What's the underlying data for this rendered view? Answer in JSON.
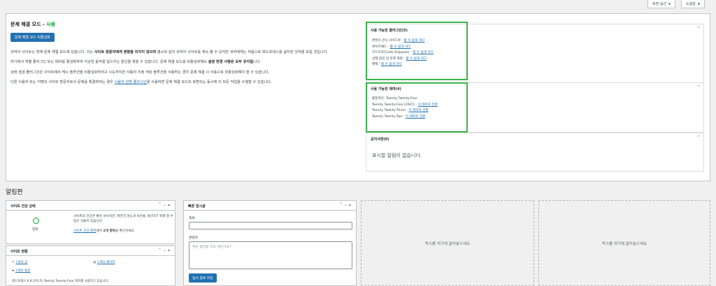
{
  "top_tabs": [
    {
      "label": "화면 옵션"
    },
    {
      "label": "도움말"
    }
  ],
  "troubleshoot": {
    "title_main": "문제 해결 모드 - ",
    "title_status": "사용",
    "disable_button": "문제 해결 모드 비활성화",
    "p1_a": "귀하의 사이트는 현재 문제 해결 모드에 있습니다. 이는 ",
    "p1_bold": "사이트 방문자에게 영향을 미치지 않으며",
    "p1_b": " 평소와 같이 귀하의 사이트를 계속 볼 수 있지만 귀하에게는 처음으로 워드프레스를 설치한 것처럼 보일 것입니다.",
    "p2_a": "여기에서 개별 플러그인 또는 테마를 활성화하여 이상한 동작을 일으키는 원인을 찾을 수 있습니다. 문제 해결 모드를 비활성화해도 ",
    "p2_bold": "설정 변경 사항은 모두 유지됩",
    "p2_b": "니다.",
    "p3": "상태 점검 플러그인은 사이트에서 캐시 솔루션을 비활성화하려고 시도하지만 사용자 지정 캐싱 솔루션을 사용하는 경우 문제 해결 시 수동으로 비활성화해야 할 수 있습니다.",
    "p4_a": "다른 사용자 또는 익명의 사이트 방문자로서 문제를 해결하려는 경우 ",
    "p4_link": "사용자 전환 플러그인",
    "p4_b": "을 사용하면 문제 해결 모드와 호환되는 동시에 이 모든 작업을 수행할 수 있습니다."
  },
  "plugins_box": {
    "title": "사용 가능한 플러그인(5)",
    "items": [
      {
        "name": "콘텐츠 안식 사이드바 - ",
        "link": "활 수 없게 하다"
      },
      {
        "name": "바이즈예드 - ",
        "link": "활 수 없게 하다"
      },
      {
        "name": "코드조각(Code Snippets) - ",
        "link": "활 수 없게 하다"
      },
      {
        "name": "상태 점검 및 문제 해결 - ",
        "link": "활 수 없게 하다"
      },
      {
        "name": "펫팩 - ",
        "link": "활 수 없게 하다"
      }
    ]
  },
  "themes_box": {
    "title": "사용 가능한 테마(4)",
    "items": [
      {
        "name": "활동적인: Twenty Twenty-Four",
        "link": ""
      },
      {
        "name": "Twenty Twenty-Five (2025) - ",
        "link": "이 테마로 전환"
      },
      {
        "name": "Twenty Twenty-Three - ",
        "link": "이 테마로 전환"
      },
      {
        "name": "Twenty Twenty-Two - ",
        "link": "이 테마로 전환"
      }
    ]
  },
  "notices_box": {
    "title": "공지사항(0)",
    "empty": "표시할 알림이 없습니다."
  },
  "dashboard": {
    "title": "알림판",
    "site_health": {
      "title": "사이트 건강 상태",
      "status": "양호",
      "desc": "사이트의 건강은 좋아 보이지만, 여전히 성능과 보안을 개선하기 위해 할 수 있는 것들이 있습니다.",
      "link": "사이트 건강 화면",
      "link_after_a": "에서 ",
      "link_after_bold": "2개 항목",
      "link_after_b": "을 확인하세요."
    },
    "site_overview": {
      "title": "사이트 현황",
      "posts": "1개의 글",
      "pages": "1개의 페이지",
      "comments": "1개의 댓글",
      "footer": "워드프레스 6.8.2이(가) Twenty Twenty-Four 테마를 사용하고 있습니다."
    },
    "quick_draft": {
      "title": "빠른 임시글",
      "title_label": "제목",
      "content_label": "콘텐츠",
      "content_placeholder": "무슨 생각을 하고 계신가요?",
      "save_button": "임시 글로 저장"
    },
    "dropzone1": "박스를 여기에 끌어놓으세요",
    "dropzone2": "박스를 여기에 끌어놓으세요"
  },
  "colors": {
    "highlight": "#3cb24a",
    "primary": "#2271b1",
    "status_ok": "#00a32a"
  }
}
